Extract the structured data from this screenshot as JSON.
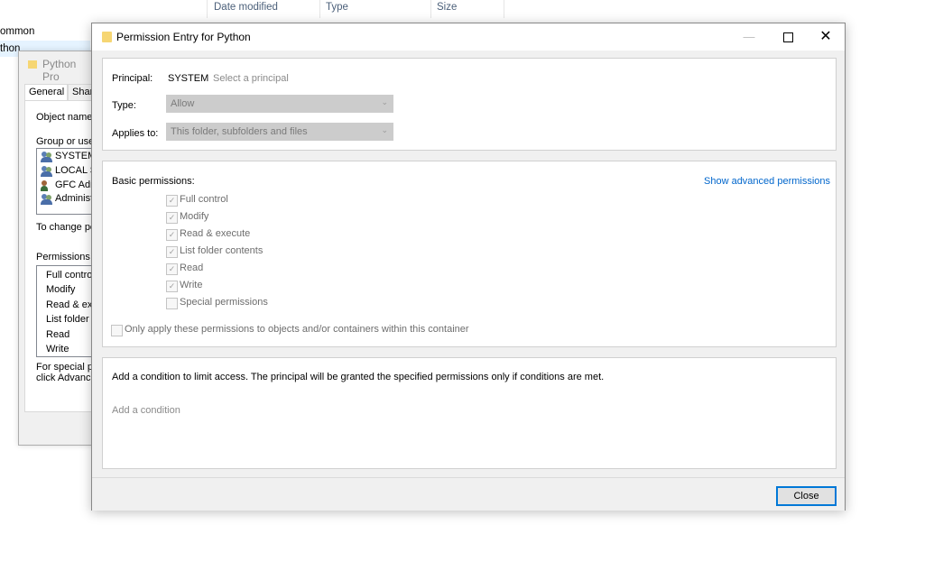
{
  "explorer": {
    "columns": [
      "Date modified",
      "Type",
      "Size"
    ],
    "tree": [
      "ommon",
      "thon"
    ]
  },
  "properties": {
    "title": "Python Pro",
    "tabs": [
      "General",
      "Sharin"
    ],
    "object_name_label": "Object name:",
    "group_label": "Group or user n",
    "users": [
      "SYSTEM",
      "LOCAL S",
      "GFC Adm",
      "Administr"
    ],
    "change_text": "To change pe",
    "permissions_label": "Permissions fo",
    "permissions": [
      "Full control",
      "Modify",
      "Read & exec",
      "List folder c",
      "Read",
      "Write"
    ],
    "special_text_1": "For special per",
    "special_text_2": "click Advance"
  },
  "dialog": {
    "title": "Permission Entry for Python",
    "principal_label": "Principal:",
    "principal_value": "SYSTEM",
    "select_principal": "Select a principal",
    "type_label": "Type:",
    "type_value": "Allow",
    "applies_label": "Applies to:",
    "applies_value": "This folder, subfolders and files",
    "basic_label": "Basic permissions:",
    "show_advanced": "Show advanced permissions",
    "permissions": [
      {
        "label": "Full control",
        "checked": true
      },
      {
        "label": "Modify",
        "checked": true
      },
      {
        "label": "Read & execute",
        "checked": true
      },
      {
        "label": "List folder contents",
        "checked": true
      },
      {
        "label": "Read",
        "checked": true
      },
      {
        "label": "Write",
        "checked": true
      },
      {
        "label": "Special permissions",
        "checked": false
      }
    ],
    "only_apply": "Only apply these permissions to objects and/or containers within this container",
    "condition_text": "Add a condition to limit access. The principal will be granted the specified permissions only if conditions are met.",
    "add_condition": "Add a condition",
    "close": "Close"
  }
}
